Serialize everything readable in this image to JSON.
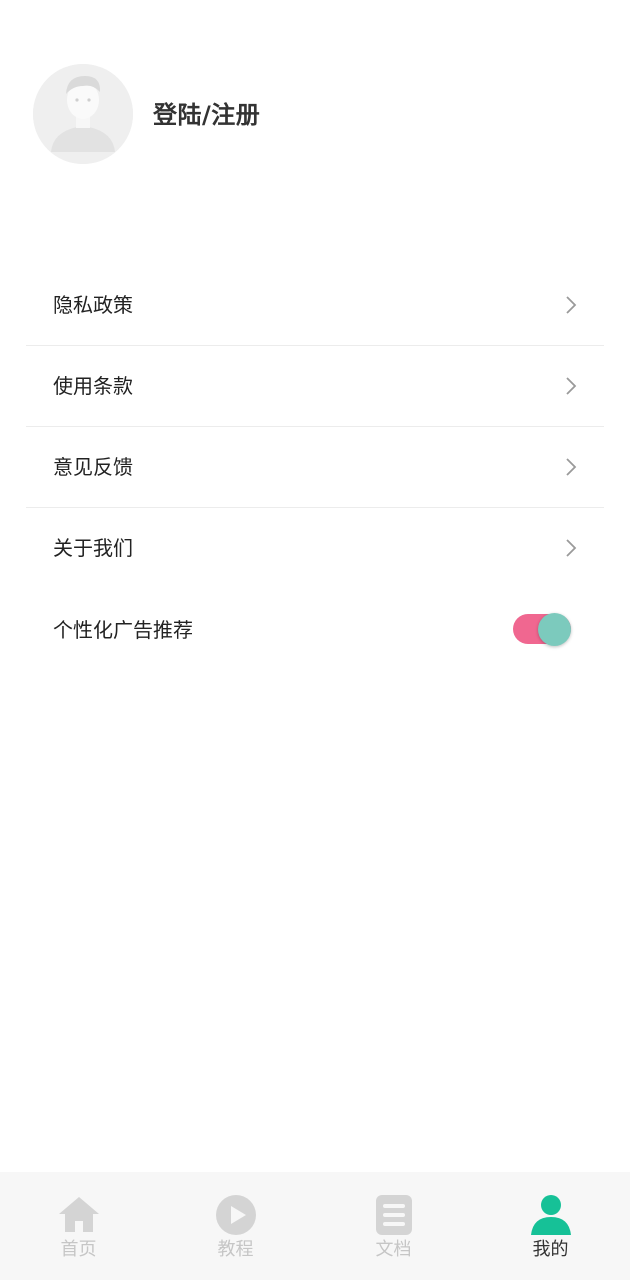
{
  "header": {
    "login_label": "登陆/注册"
  },
  "menu": {
    "items": [
      {
        "label": "隐私政策"
      },
      {
        "label": "使用条款"
      },
      {
        "label": "意见反馈"
      },
      {
        "label": "关于我们"
      }
    ],
    "ad_toggle": {
      "label": "个性化广告推荐",
      "on": true
    }
  },
  "tabbar": {
    "tabs": [
      {
        "label": "首页",
        "icon": "home-icon",
        "active": false
      },
      {
        "label": "教程",
        "icon": "play-icon",
        "active": false
      },
      {
        "label": "文档",
        "icon": "document-icon",
        "active": false
      },
      {
        "label": "我的",
        "icon": "user-icon",
        "active": true
      }
    ]
  },
  "colors": {
    "toggle_track": "#f06790",
    "toggle_knob": "#7ccabd",
    "active_tab_icon": "#16c197",
    "inactive_tab": "#c6c6c6"
  }
}
